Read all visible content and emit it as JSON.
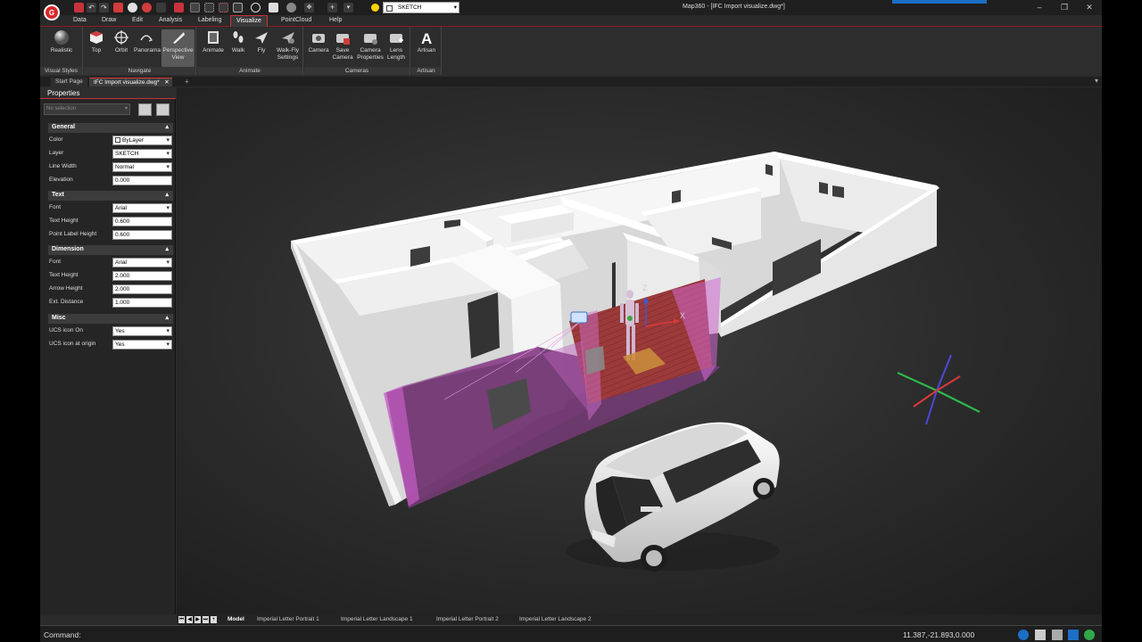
{
  "window": {
    "title": "Map360 - [IFC Import visualize.dwg*]",
    "layer_combo": "SKETCH"
  },
  "menu": {
    "tabs": [
      "Data",
      "Draw",
      "Edit",
      "Analysis",
      "Labeling",
      "Visualize",
      "PointCloud",
      "Help"
    ],
    "active": "Visualize"
  },
  "ribbon": {
    "panels": [
      {
        "label": "Visual Styles",
        "buttons": [
          {
            "label": "Realistic",
            "icon": "sphere-icon"
          }
        ]
      },
      {
        "label": "Navigate",
        "buttons": [
          {
            "label": "Top",
            "icon": "cube-top-icon"
          },
          {
            "label": "Orbit",
            "icon": "orbit-icon"
          },
          {
            "label": "Panorama",
            "icon": "panorama-icon"
          },
          {
            "label": "Perspective View",
            "icon": "perspective-icon",
            "active": true
          }
        ]
      },
      {
        "label": "Animate",
        "buttons": [
          {
            "label": "Animate",
            "icon": "film-icon"
          },
          {
            "label": "Walk",
            "icon": "footprints-icon"
          },
          {
            "label": "Fly",
            "icon": "plane-icon"
          },
          {
            "label": "Walk-Fly Settings",
            "icon": "walkfly-settings-icon"
          }
        ]
      },
      {
        "label": "Cameras",
        "buttons": [
          {
            "label": "Camera",
            "icon": "camera-icon"
          },
          {
            "label": "Save Camera",
            "icon": "save-camera-icon"
          },
          {
            "label": "Camera Properties",
            "icon": "camera-properties-icon"
          },
          {
            "label": "Lens Length",
            "icon": "lens-icon"
          }
        ]
      },
      {
        "label": "Artisan",
        "buttons": [
          {
            "label": "Artisan",
            "icon": "artisan-icon"
          }
        ]
      }
    ]
  },
  "doc_tabs": [
    {
      "label": "Start Page",
      "active": false
    },
    {
      "label": "IFC Import visualize.dwg*",
      "active": true
    }
  ],
  "properties": {
    "title": "Properties",
    "selection_placeholder": "No selection",
    "sections": [
      {
        "title": "General",
        "rows": [
          {
            "label": "Color",
            "value": "ByLayer",
            "dropdown": true
          },
          {
            "label": "Layer",
            "value": "SKETCH",
            "dropdown": true
          },
          {
            "label": "Line Width",
            "value": "Normal",
            "dropdown": true
          },
          {
            "label": "Elevation",
            "value": "0.000",
            "dropdown": false
          }
        ]
      },
      {
        "title": "Text",
        "rows": [
          {
            "label": "Font",
            "value": "Arial",
            "dropdown": true
          },
          {
            "label": "Text Height",
            "value": "0.600",
            "dropdown": false
          },
          {
            "label": "Point Label Height",
            "value": "0.600",
            "dropdown": false
          }
        ]
      },
      {
        "title": "Dimension",
        "rows": [
          {
            "label": "Font",
            "value": "Arial",
            "dropdown": true
          },
          {
            "label": "Text Height",
            "value": "2.000",
            "dropdown": false
          },
          {
            "label": "Arrow Height",
            "value": "2.000",
            "dropdown": false
          },
          {
            "label": "Ext. Distance",
            "value": "1.000",
            "dropdown": false
          }
        ]
      },
      {
        "title": "Misc",
        "rows": [
          {
            "label": "UCS icon On",
            "value": "Yes",
            "dropdown": true
          },
          {
            "label": "UCS icon at origin",
            "value": "Yes",
            "dropdown": true
          }
        ]
      }
    ]
  },
  "viewport": {
    "gizmo_labels": {
      "x": "X",
      "z": "Z"
    }
  },
  "layout_tabs": {
    "model": "Model",
    "layouts": [
      "Imperial Letter Portrait 1",
      "Imperial Letter Landscape 1",
      "Imperial Letter Portrait 2",
      "Imperial Letter Landscape 2"
    ]
  },
  "status": {
    "command_label": "Command:",
    "coordinates": "11.387,-21.893,0.000"
  },
  "colors": {
    "accent": "#c8323c",
    "brand": "#d9282b",
    "selection_pink": "#c050c0"
  }
}
